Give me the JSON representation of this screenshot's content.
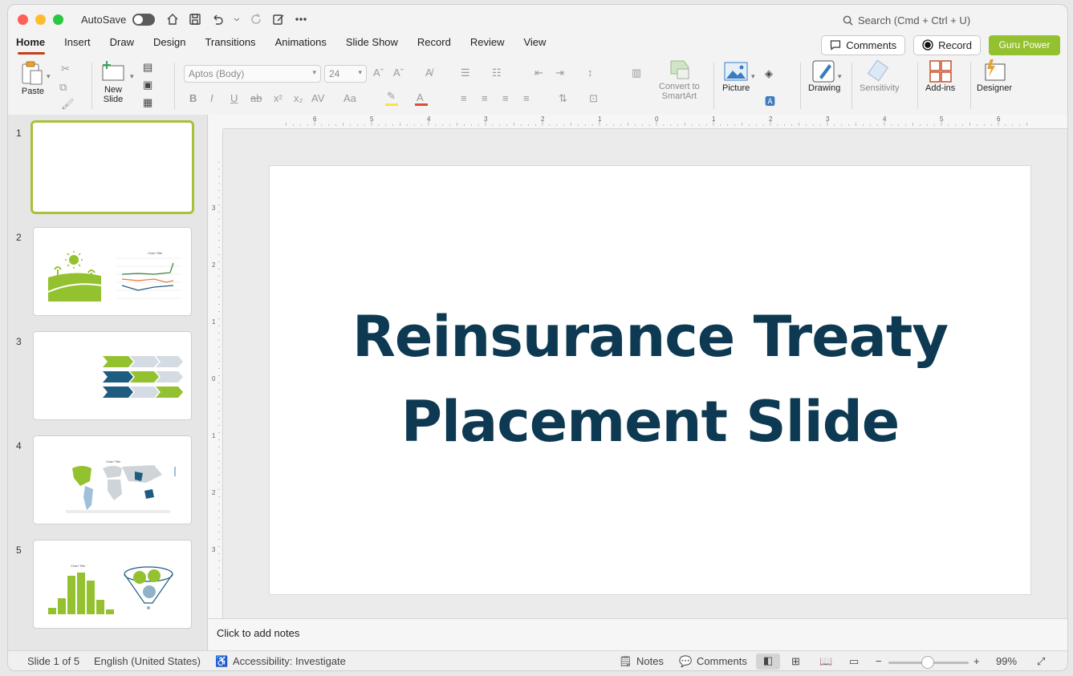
{
  "window": {
    "autosave_label": "AutoSave",
    "search_placeholder": "Search (Cmd + Ctrl + U)"
  },
  "tabs": [
    "Home",
    "Insert",
    "Draw",
    "Design",
    "Transitions",
    "Animations",
    "Slide Show",
    "Record",
    "Review",
    "View"
  ],
  "tab_actions": {
    "comments": "Comments",
    "record": "Record",
    "guru": "Guru Power"
  },
  "ribbon": {
    "paste": "Paste",
    "new_slide_1": "New",
    "new_slide_2": "Slide",
    "font_name": "Aptos (Body)",
    "font_size": "24",
    "smartart_1": "Convert to",
    "smartart_2": "SmartArt",
    "picture": "Picture",
    "drawing": "Drawing",
    "sensitivity": "Sensitivity",
    "addins": "Add-ins",
    "designer": "Designer"
  },
  "thumbnails": {
    "numbers": [
      "1",
      "2",
      "3",
      "4",
      "5"
    ],
    "chart_title": "Chart Title"
  },
  "ruler": {
    "h_labels": [
      "6",
      "5",
      "4",
      "3",
      "2",
      "1",
      "0",
      "1",
      "2",
      "3",
      "4",
      "5",
      "6"
    ],
    "v_labels": [
      "3",
      "2",
      "1",
      "0",
      "1",
      "2",
      "3"
    ]
  },
  "slide": {
    "title_line1": "Reinsurance Treaty",
    "title_line2": "Placement Slide"
  },
  "notes_placeholder": "Click to add notes",
  "status": {
    "slide_of": "Slide 1 of 5",
    "language": "English (United States)",
    "accessibility": "Accessibility: Investigate",
    "notes": "Notes",
    "comments": "Comments",
    "zoom": "99%"
  },
  "colors": {
    "accent_green": "#94c12f",
    "title_navy": "#0d3a52",
    "tab_underline": "#c43e1c"
  }
}
